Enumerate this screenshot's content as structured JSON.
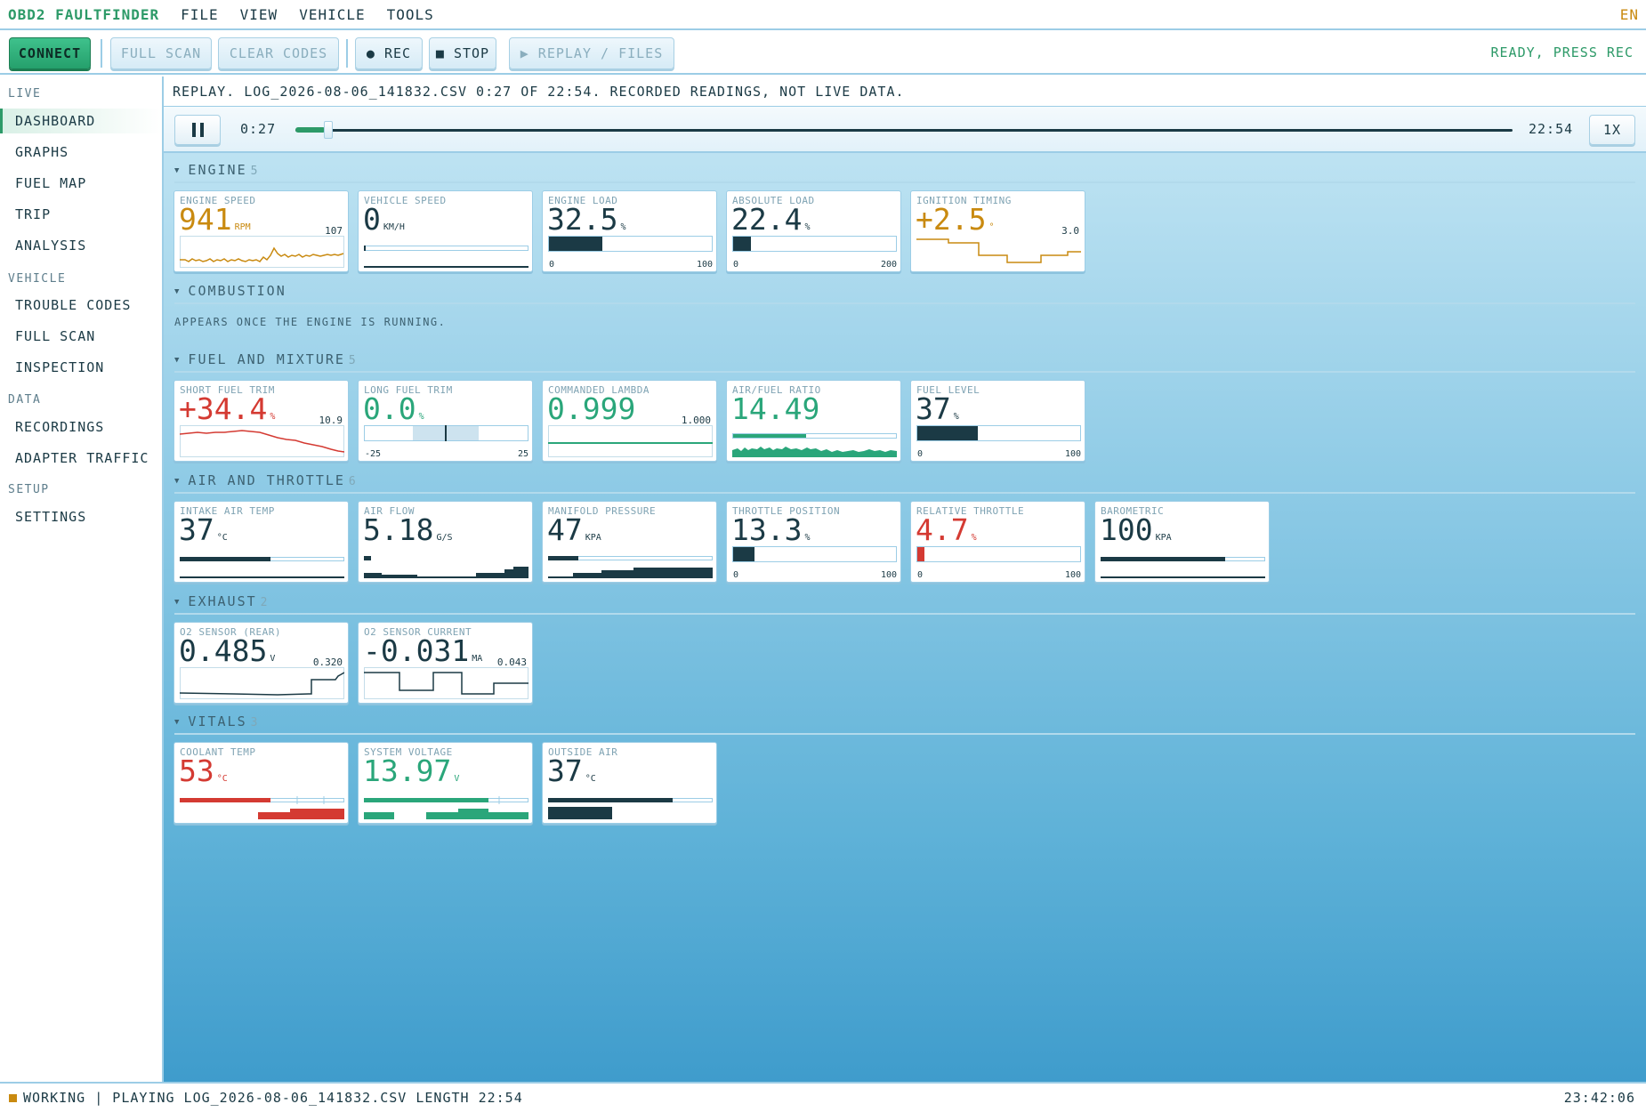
{
  "colors": {
    "accent": "#2d9a68",
    "warn": "#c98a10",
    "alert": "#d43a32",
    "ink": "#1b3a45",
    "good": "#2aa67a"
  },
  "menu": {
    "app_title": "OBD2 FAULTFINDER",
    "items": [
      "FILE",
      "VIEW",
      "VEHICLE",
      "TOOLS"
    ],
    "lang": "EN"
  },
  "toolbar": {
    "connect": "CONNECT",
    "full_scan": "FULL SCAN",
    "clear_codes": "CLEAR CODES",
    "rec": "● REC",
    "stop": "■ STOP",
    "replay": "▶ REPLAY / FILES",
    "status": "READY, PRESS REC"
  },
  "sidebar": {
    "sections": [
      {
        "title": "LIVE",
        "items": [
          "DASHBOARD",
          "GRAPHS",
          "FUEL MAP",
          "TRIP",
          "ANALYSIS"
        ]
      },
      {
        "title": "VEHICLE",
        "items": [
          "TROUBLE CODES",
          "FULL SCAN",
          "INSPECTION"
        ]
      },
      {
        "title": "DATA",
        "items": [
          "RECORDINGS",
          "ADAPTER TRAFFIC"
        ]
      },
      {
        "title": "SETUP",
        "items": [
          "SETTINGS"
        ]
      }
    ],
    "active": "DASHBOARD"
  },
  "replay": {
    "banner": "REPLAY. LOG_2026-08-06_141832.CSV 0:27 OF 22:54. RECORDED READINGS, NOT LIVE DATA.",
    "current": "0:27",
    "total": "22:54",
    "progress": 0.02,
    "speed": "1X"
  },
  "groups": {
    "engine": {
      "title": "ENGINE",
      "count": "5"
    },
    "combustion": {
      "title": "COMBUSTION",
      "empty": "APPEARS ONCE THE ENGINE IS RUNNING."
    },
    "fuel": {
      "title": "FUEL AND MIXTURE",
      "count": "5"
    },
    "air": {
      "title": "AIR AND THROTTLE",
      "count": "6"
    },
    "exhaust": {
      "title": "EXHAUST",
      "count": "2"
    },
    "vitals": {
      "title": "VITALS",
      "count": "3"
    }
  },
  "cards": {
    "engine_speed": {
      "label": "ENGINE SPEED",
      "value": "941",
      "unit": "RPM",
      "aux": "107",
      "color": "#c98a10"
    },
    "vehicle_speed": {
      "label": "VEHICLE SPEED",
      "value": "0",
      "unit": "KM/H",
      "color": "#1b3a45"
    },
    "engine_load": {
      "label": "ENGINE LOAD",
      "value": "32.5",
      "unit": "%",
      "min": "0",
      "max": "100",
      "level": 0.325,
      "color": "#1b3a45"
    },
    "absolute_load": {
      "label": "ABSOLUTE LOAD",
      "value": "22.4",
      "unit": "%",
      "min": "0",
      "max": "200",
      "level": 0.112,
      "color": "#1b3a45"
    },
    "ignition_timing": {
      "label": "IGNITION TIMING",
      "value": "+2.5",
      "unit": "°",
      "aux": "3.0",
      "color": "#c98a10"
    },
    "short_fuel_trim": {
      "label": "SHORT FUEL TRIM",
      "value": "+34.4",
      "unit": "%",
      "aux": "10.9",
      "color": "#d43a32"
    },
    "long_fuel_trim": {
      "label": "LONG FUEL TRIM",
      "value": "0.0",
      "unit": "%",
      "min": "-25",
      "max": "25",
      "color": "#2aa67a"
    },
    "commanded_lambda": {
      "label": "COMMANDED LAMBDA",
      "value": "0.999",
      "unit": "",
      "aux": "1.000",
      "color": "#2aa67a"
    },
    "air_fuel_ratio": {
      "label": "AIR/FUEL RATIO",
      "value": "14.49",
      "unit": "",
      "color": "#2aa67a"
    },
    "fuel_level": {
      "label": "FUEL LEVEL",
      "value": "37",
      "unit": "%",
      "min": "0",
      "max": "100",
      "level": 0.37,
      "color": "#1b3a45"
    },
    "intake_air_temp": {
      "label": "INTAKE AIR TEMP",
      "value": "37",
      "unit": "°C",
      "color": "#1b3a45"
    },
    "air_flow": {
      "label": "AIR FLOW",
      "value": "5.18",
      "unit": "G/S",
      "color": "#1b3a45"
    },
    "manifold_pressure": {
      "label": "MANIFOLD PRESSURE",
      "value": "47",
      "unit": "KPA",
      "color": "#1b3a45"
    },
    "throttle_position": {
      "label": "THROTTLE POSITION",
      "value": "13.3",
      "unit": "%",
      "min": "0",
      "max": "100",
      "level": 0.133,
      "color": "#1b3a45"
    },
    "relative_throttle": {
      "label": "RELATIVE THROTTLE",
      "value": "4.7",
      "unit": "%",
      "min": "0",
      "max": "100",
      "level": 0.047,
      "color": "#d43a32"
    },
    "barometric": {
      "label": "BAROMETRIC",
      "value": "100",
      "unit": "KPA",
      "color": "#1b3a45"
    },
    "o2_rear": {
      "label": "O2 SENSOR (REAR)",
      "value": "0.485",
      "unit": "V",
      "aux": "0.320",
      "color": "#1b3a45"
    },
    "o2_current": {
      "label": "O2 SENSOR CURRENT",
      "value": "-0.031",
      "unit": "MA",
      "aux": "0.043",
      "color": "#1b3a45"
    },
    "coolant_temp": {
      "label": "COOLANT TEMP",
      "value": "53",
      "unit": "°C",
      "color": "#d43a32"
    },
    "system_voltage": {
      "label": "SYSTEM VOLTAGE",
      "value": "13.97",
      "unit": "V",
      "color": "#2aa67a"
    },
    "outside_air": {
      "label": "OUTSIDE AIR",
      "value": "37",
      "unit": "°C",
      "color": "#1b3a45"
    }
  },
  "statusbar": {
    "message": "WORKING | PLAYING LOG_2026-08-06_141832.CSV LENGTH 22:54",
    "clock": "23:42:06"
  }
}
